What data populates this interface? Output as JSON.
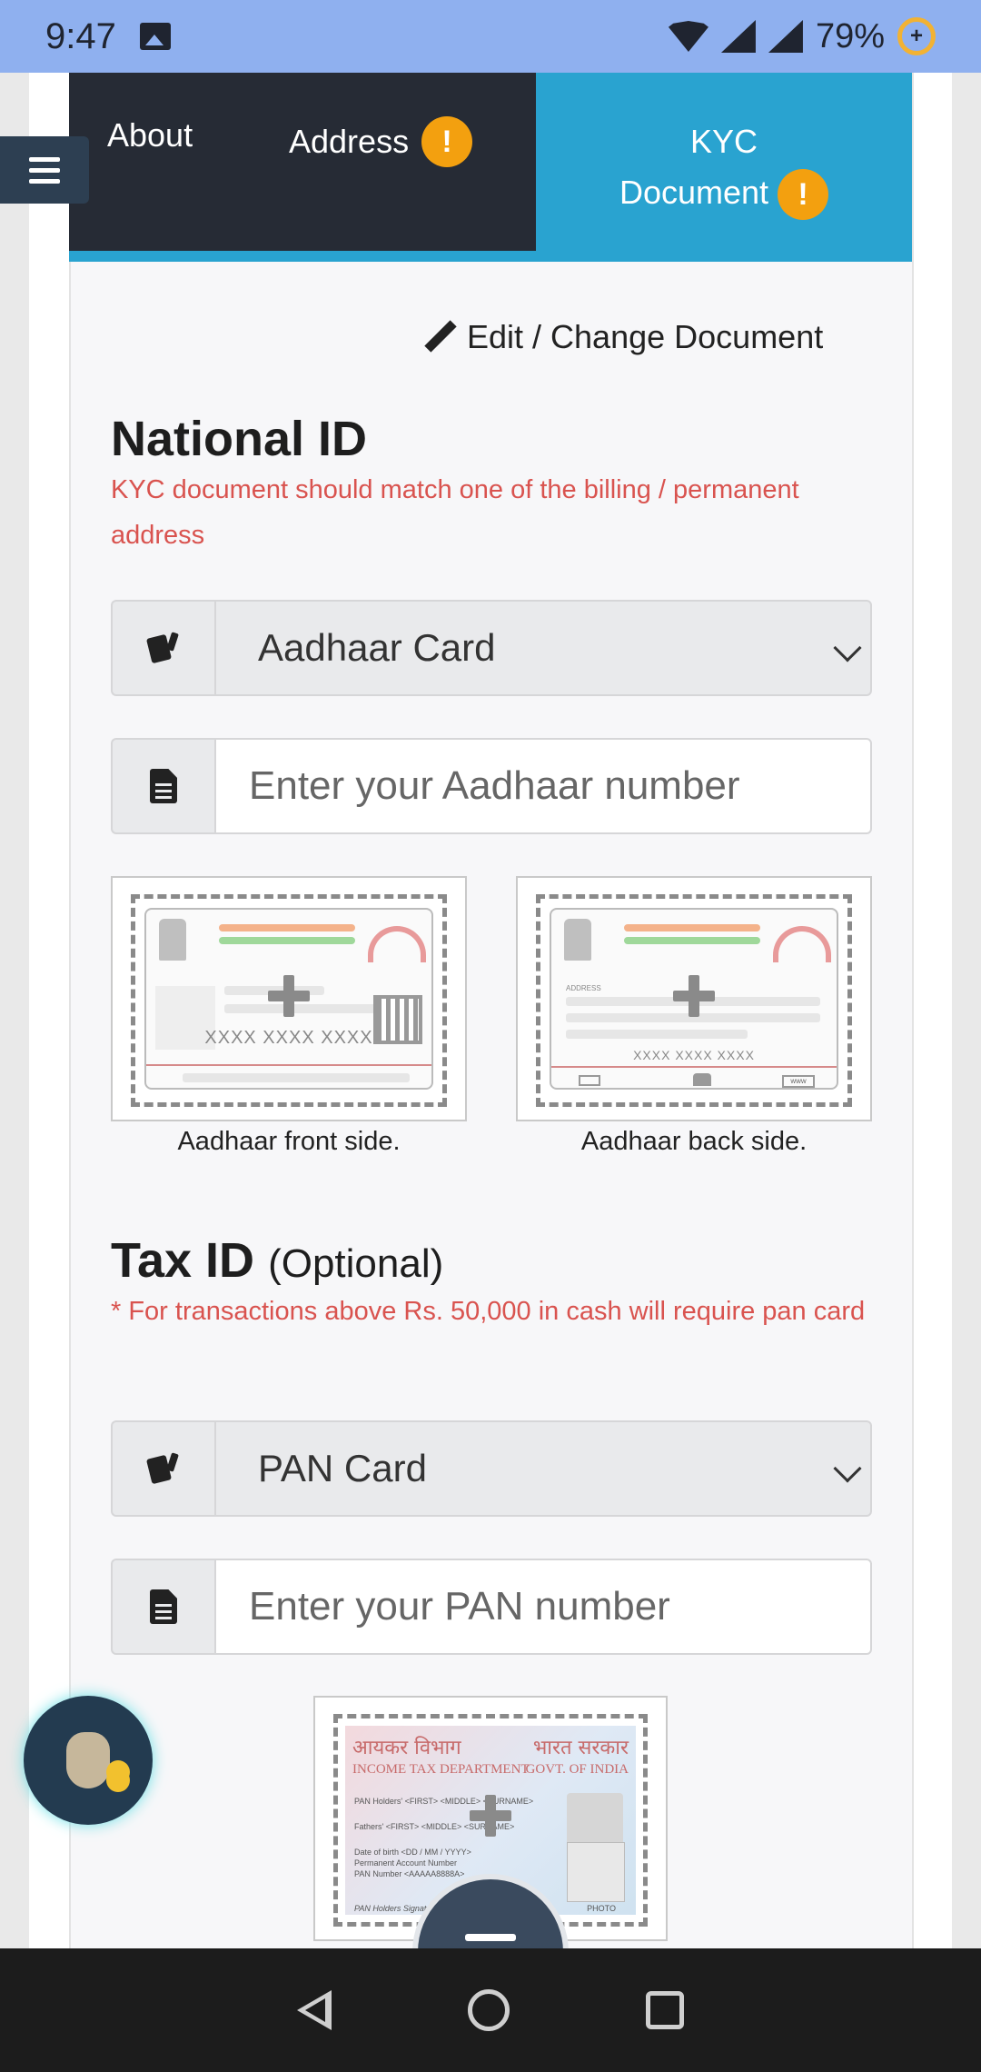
{
  "status_bar": {
    "time": "9:47",
    "battery": "79%"
  },
  "tabs": {
    "about": "About",
    "address": "Address",
    "kyc_line1": "KYC",
    "kyc_line2": "Document",
    "alert_symbol": "!"
  },
  "edit_link": "Edit / Change Document",
  "national": {
    "title": "National ID",
    "note": "KYC document should match one of the billing / permanent address",
    "select_value": "Aadhaar Card",
    "input_placeholder": "Enter your Aadhaar number",
    "front_caption": "Aadhaar front side.",
    "back_caption": "Aadhaar back side.",
    "front_number": "XXXX XXXX XXXX",
    "back_number": "XXXX XXXX XXXX",
    "back_address_label": "ADDRESS",
    "back_footer_right": "www"
  },
  "tax": {
    "title": "Tax ID",
    "optional": "(Optional)",
    "note": "* For transactions above Rs. 50,000 in cash will require pan card",
    "select_value": "PAN Card",
    "input_placeholder": "Enter your PAN number",
    "pan_card": {
      "hindi_left": "आयकर विभाग",
      "hindi_right": "भारत सरकार",
      "dept_left": "INCOME TAX DEPARTMENT",
      "dept_right": "GOVT. OF INDIA",
      "line1": "PAN Holders' <FIRST> <MIDDLE> <SURNAME>",
      "line2": "Fathers' <FIRST> <MIDDLE> <SURNAME>",
      "line3": "Date of birth <DD / MM / YYYY>",
      "line4": "Permanent Account Number",
      "line5": "PAN Number <AAAAA8888A>",
      "line6": "PAN Holders Signature",
      "photo_label": "PHOTO"
    }
  },
  "colors": {
    "accent": "#29a3d0",
    "tab_dark": "#262b35",
    "alert": "#f3a00f",
    "note_red": "#d9534f",
    "status_bar": "#8fb0ef"
  }
}
